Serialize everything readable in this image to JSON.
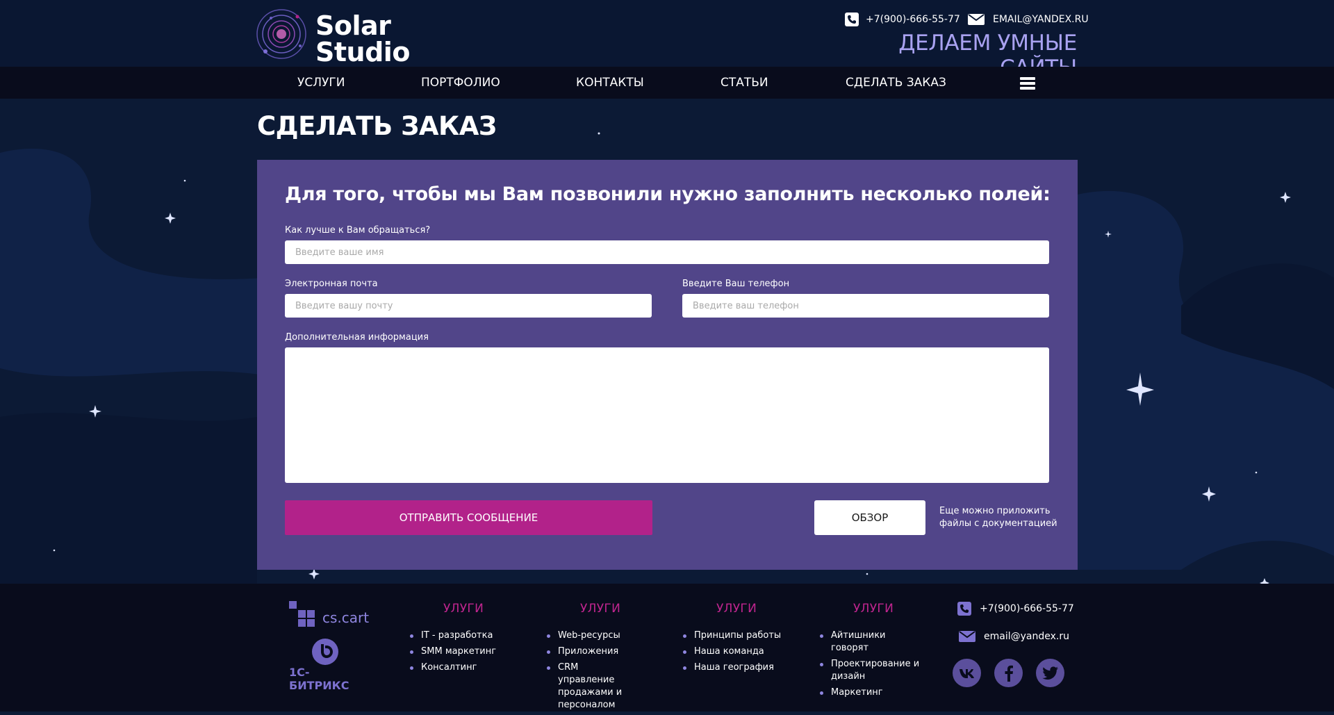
{
  "header": {
    "logo_line1": "Solar",
    "logo_line2": "Studio",
    "phone": "+7(900)-666-55-77",
    "email": "EMAIL@YANDEX.RU",
    "slogan": "ДЕЛАЕМ УМНЫЕ САЙТЫ"
  },
  "nav": {
    "items": [
      "УСЛУГИ",
      "ПОРТФОЛИО",
      "КОНТАКТЫ",
      "СТАТЬИ",
      "СДЕЛАТЬ ЗАКАЗ"
    ],
    "menu_icon": "hamburger-icon"
  },
  "page": {
    "title": "СДЕЛАТЬ ЗАКАЗ"
  },
  "form": {
    "heading": "Для того, чтобы мы Вам позвонили нужно заполнить несколько полей:",
    "name_label": "Как лучше к Вам обращаться?",
    "name_placeholder": "Введите ваше имя",
    "email_label": "Электронная почта",
    "email_placeholder": "Введите вашу почту",
    "phone_label": "Введите Ваш телефон",
    "phone_placeholder": "Введите ваш телефон",
    "info_label": "Дополнительная информация",
    "info_value": "",
    "send_label": "ОТПРАВИТЬ СООБЩЕНИЕ",
    "browse_label": "ОБЗОР",
    "attach_hint": "Еще можно приложить файлы с документацией"
  },
  "footer": {
    "partners": [
      "cs.cart",
      "1С-БИТРИКС"
    ],
    "columns": [
      {
        "title": "УЛУГИ",
        "items": [
          "IT - разработка",
          "SMM маркетинг",
          "Консалтинг"
        ]
      },
      {
        "title": "УЛУГИ",
        "items": [
          "Web-ресурсы",
          "Приложения",
          "CRM управление продажами и персоналом"
        ]
      },
      {
        "title": "УЛУГИ",
        "items": [
          "Принципы работы",
          "Наша команда",
          "Наша география"
        ]
      },
      {
        "title": "УЛУГИ",
        "items": [
          "Айтишники говорят",
          "Проектирование и дизайн",
          "Маркетинг"
        ]
      }
    ],
    "phone": "+7(900)-666-55-77",
    "email": "email@yandex.ru",
    "social": [
      "vk-icon",
      "facebook-icon",
      "twitter-icon"
    ]
  },
  "colors": {
    "background": "#0c1a35",
    "panel": "#514589",
    "accent": "#b2228a",
    "slogan": "#a9a2f1"
  }
}
